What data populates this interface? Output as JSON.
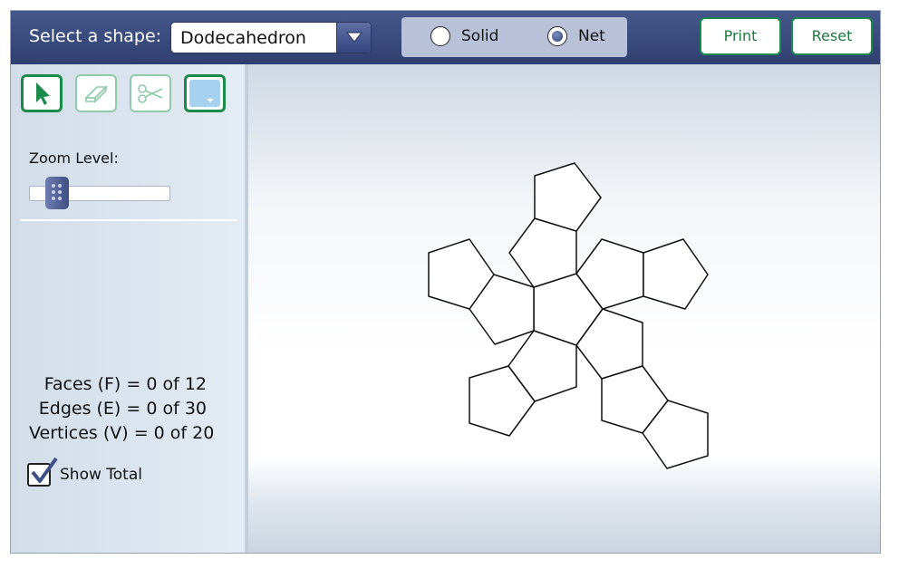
{
  "header": {
    "select_label": "Select a shape:",
    "shape_value": "Dodecahedron",
    "view": {
      "options": [
        {
          "label": "Solid",
          "selected": false
        },
        {
          "label": "Net",
          "selected": true
        }
      ]
    },
    "print_label": "Print",
    "reset_label": "Reset"
  },
  "toolbar": {
    "tools": [
      {
        "icon": "cursor-arrow-icon",
        "active": true
      },
      {
        "icon": "eraser-icon",
        "active": false
      },
      {
        "icon": "scissors-icon",
        "active": false
      },
      {
        "icon": "color-dropdown-icon",
        "active": true
      }
    ]
  },
  "zoom": {
    "label": "Zoom Level:",
    "level": 0.15
  },
  "counts": {
    "faces": "Faces (F) = 0 of 12",
    "edges": "Edges (E) = 0 of 30",
    "vertices": "Vertices (V) = 0 of 20"
  },
  "show_total": {
    "label": "Show Total",
    "checked": true
  },
  "colors": {
    "header_bg": "#3a4b7e",
    "accent_green": "#1c8a4a",
    "toggle_bg": "#b8c1d8"
  }
}
